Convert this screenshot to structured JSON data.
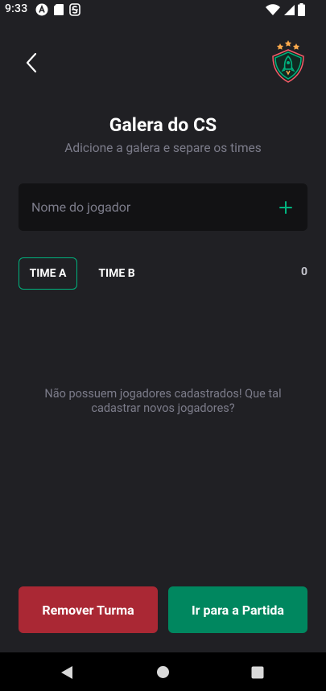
{
  "status_bar": {
    "time": "9:33",
    "left_icons": [
      "letter-a-circle-icon",
      "sd-card-icon",
      "strikethrough-s-icon"
    ],
    "right_icons": [
      "wifi-icon",
      "signal-icon",
      "battery-icon"
    ]
  },
  "header": {
    "back_icon": "chevron-left-icon",
    "logo_icon": "rocket-shield-logo",
    "title": "Galera do CS",
    "subtitle": "Adicione a galera e separe os times"
  },
  "player_form": {
    "placeholder": "Nome do jogador",
    "value": "",
    "add_icon": "plus-icon"
  },
  "tabs": [
    {
      "label": "TIME A",
      "selected": true
    },
    {
      "label": "TIME B",
      "selected": false
    }
  ],
  "players_count": "0",
  "empty_message": "Não possuem jogadores cadastrados! Que tal cadastrar novos jogadores?",
  "footer": {
    "remove_label": "Remover Turma",
    "match_label": "Ir para a Partida"
  },
  "colors": {
    "background": "#202024",
    "input_background": "#121214",
    "accent_green": "#00b37e",
    "button_green": "#00875f",
    "button_red": "#aa2834",
    "muted_text": "#7c7c8a"
  },
  "nav_bar": {
    "icons": [
      "nav-back-icon",
      "nav-home-icon",
      "nav-recents-icon"
    ]
  }
}
